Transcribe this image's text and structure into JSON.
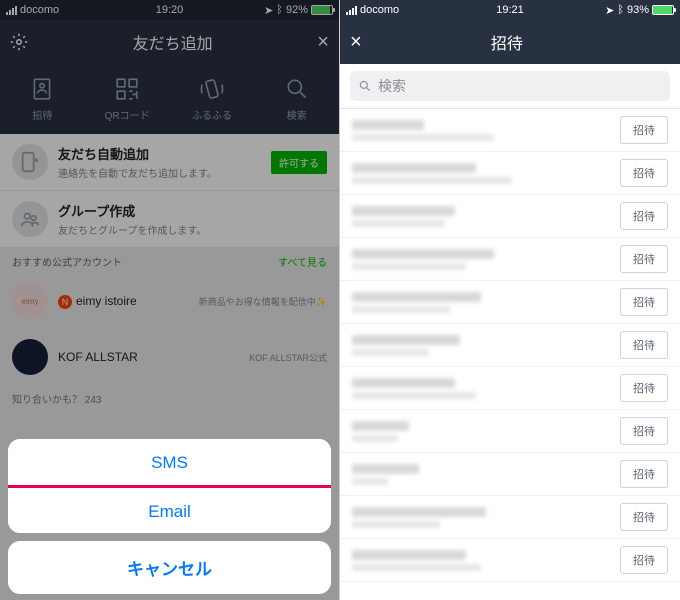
{
  "left": {
    "status": {
      "carrier": "docomo",
      "time": "19:20",
      "bt": "92%"
    },
    "nav_title": "友だち追加",
    "icons": [
      {
        "label": "招待"
      },
      {
        "label": "QRコード"
      },
      {
        "label": "ふるふる"
      },
      {
        "label": "検索"
      }
    ],
    "auto": {
      "title": "友だち自動追加",
      "sub": "連絡先を自動で友だち追加します。",
      "btn": "許可する"
    },
    "group": {
      "title": "グループ作成",
      "sub": "友だちとグループを作成します。"
    },
    "section_official": "おすすめ公式アカウント",
    "see_all": "すべて見る",
    "accts": [
      {
        "name": "eimy istoire",
        "desc": "新商品やお得な情報を配信中✨"
      },
      {
        "name": "KOF ALLSTAR",
        "desc": "KOF ALLSTAR公式"
      }
    ],
    "maybe": "知り合いかも？ 243",
    "sheet": {
      "sms": "SMS",
      "email": "Email",
      "cancel": "キャンセル"
    }
  },
  "right": {
    "status": {
      "carrier": "docomo",
      "time": "19:21",
      "bt": "93%"
    },
    "nav_title": "招待",
    "search_placeholder": "検索",
    "invite_label": "招待",
    "contact_count": 11
  }
}
